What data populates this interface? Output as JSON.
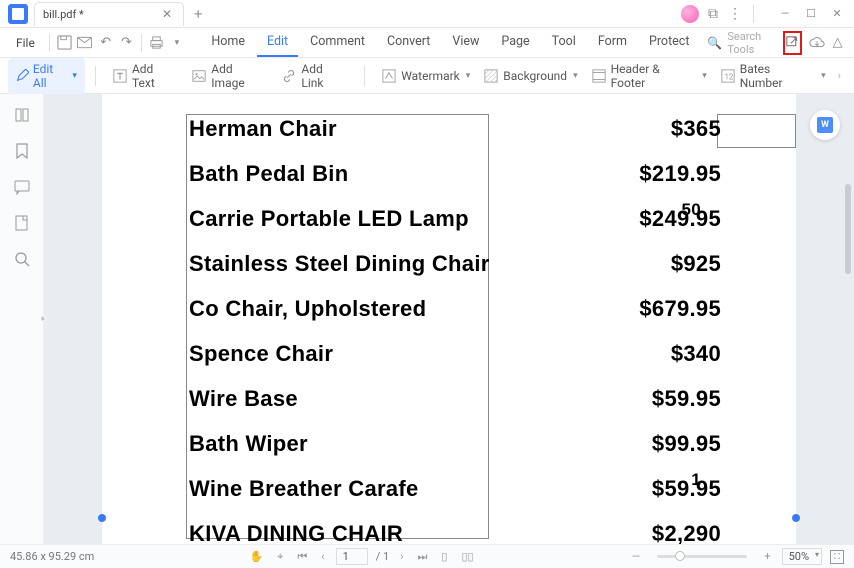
{
  "window": {
    "tab_title": "bill.pdf *"
  },
  "menu": {
    "file": "File",
    "tabs": {
      "home": "Home",
      "edit": "Edit",
      "comment": "Comment",
      "convert": "Convert",
      "view": "View",
      "page": "Page",
      "tool": "Tool",
      "form": "Form",
      "protect": "Protect"
    },
    "search_placeholder": "Search Tools"
  },
  "toolbar": {
    "edit_all": "Edit All",
    "add_text": "Add Text",
    "add_image": "Add Image",
    "add_link": "Add Link",
    "watermark": "Watermark",
    "background": "Background",
    "header_footer": "Header & Footer",
    "bates_number": "Bates Number"
  },
  "document": {
    "lines": [
      {
        "name": "Herman Chair",
        "price": "$365"
      },
      {
        "name": "Bath Pedal Bin",
        "price": "$219.95"
      },
      {
        "name": "Carrie Portable LED Lamp",
        "price": "$249.95",
        "overlay": "50"
      },
      {
        "name": "Stainless Steel Dining Chair",
        "price": "$925"
      },
      {
        "name": "Co Chair, Upholstered",
        "price": "$679.95"
      },
      {
        "name": "Spence Chair",
        "price": "$340"
      },
      {
        "name": "Wire Base",
        "price": "$59.95"
      },
      {
        "name": "Bath Wiper",
        "price": "$99.95"
      },
      {
        "name": "Wine Breather Carafe",
        "price": "$59.95",
        "overlay": "1"
      },
      {
        "name": "KIVA DINING CHAIR",
        "price": "$2,290"
      }
    ]
  },
  "status": {
    "dimensions": "45.86 x 95.29 cm",
    "page_current": "1",
    "page_total": "/ 1",
    "zoom": "50%"
  },
  "word_badge": "W"
}
